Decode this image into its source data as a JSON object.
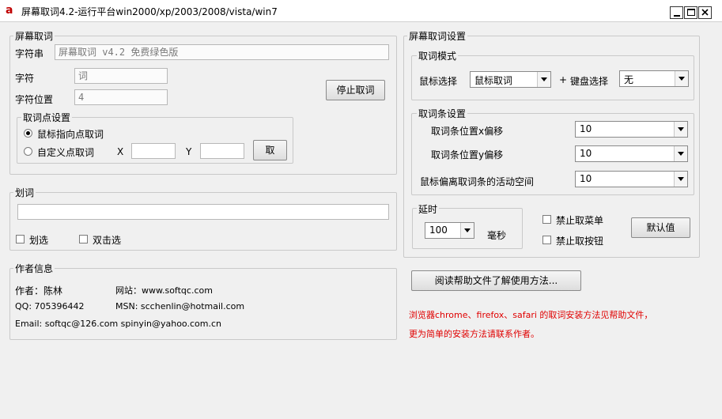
{
  "window": {
    "title": "屏幕取词4.2-运行平台win2000/xp/2003/2008/vista/win7",
    "app_icon": "a",
    "minimize_icon": "minimize-icon",
    "maximize_icon": "maximize-icon",
    "close_icon": "close-icon"
  },
  "capture": {
    "title": "屏幕取词",
    "string_label": "字符串",
    "string_value": "屏幕取词 v4.2 免费绿色版",
    "char_label": "字符",
    "char_value": "词",
    "pos_label": "字符位置",
    "pos_value": "4",
    "stop_button": "停止取词",
    "point": {
      "title": "取词点设置",
      "radio_mouse": "鼠标指向点取词",
      "radio_custom": "自定义点取词",
      "x_label": "X",
      "y_label": "Y",
      "x_value": "",
      "y_value": "",
      "take_button": "取"
    }
  },
  "select_words": {
    "title": "划词",
    "input_value": "",
    "check_select": "划选",
    "check_double": "双击选"
  },
  "author": {
    "title": "作者信息",
    "name": "作者：陈林",
    "website": "网站：www.softqc.com",
    "qq": "QQ: 705396442",
    "msn": "MSN:  scchenlin@hotmail.com",
    "email": "Email: softqc@126.com   spinyin@yahoo.com.cn"
  },
  "settings": {
    "title": "屏幕取词设置",
    "mode": {
      "title": "取词模式",
      "mouse_label": "鼠标选择",
      "mouse_value": "鼠标取词",
      "plus": "+",
      "keyboard_label": "键盘选择",
      "keyboard_value": "无"
    },
    "bar": {
      "title": "取词条设置",
      "x_label": "取词条位置x偏移",
      "x_value": "10",
      "y_label": "取词条位置y偏移",
      "y_value": "10",
      "space_label": "鼠标偏离取词条的活动空间",
      "space_value": "10"
    },
    "delay": {
      "title": "延时",
      "value": "100",
      "unit": "毫秒"
    },
    "disable_menu": "禁止取菜单",
    "disable_button": "禁止取按钮",
    "default_button": "默认值"
  },
  "help_button": "阅读帮助文件了解使用方法...",
  "notice": {
    "line1": "浏览器chrome、firefox、safari 的取词安装方法见帮助文件，",
    "line2": "更为简单的安装方法请联系作者。",
    "color": "#e00000"
  }
}
